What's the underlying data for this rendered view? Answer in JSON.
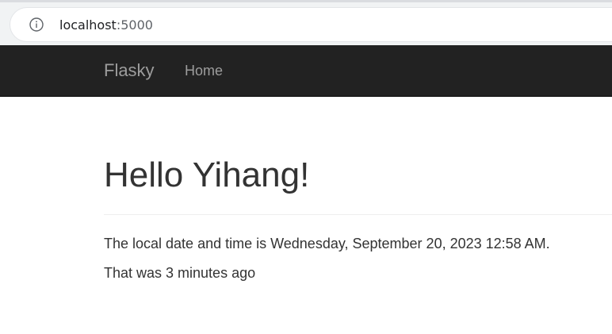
{
  "browser": {
    "url_host": "localhost",
    "url_port": ":5000",
    "info_icon": "info-icon"
  },
  "navbar": {
    "brand": "Flasky",
    "home_label": "Home"
  },
  "main": {
    "heading": "Hello Yihang!",
    "datetime_text": "The local date and time is Wednesday, September 20, 2023 12:58 AM.",
    "relative_text": "That was 3 minutes ago"
  },
  "colors": {
    "navbar_bg": "#222222",
    "navbar_text": "#9d9d9d",
    "body_text": "#333333"
  }
}
